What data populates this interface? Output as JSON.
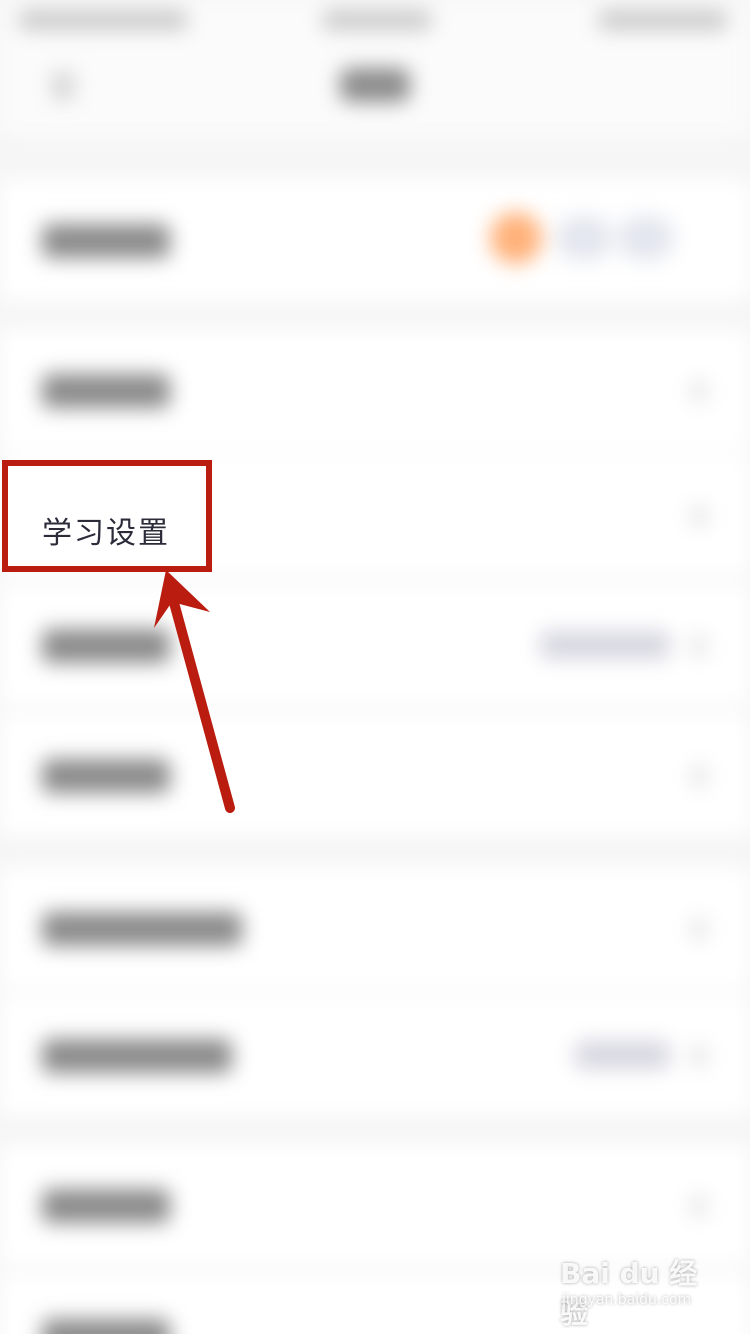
{
  "highlight": {
    "label": "学习设置"
  },
  "colors": {
    "highlight_border": "#bb1c10",
    "arrow": "#bb1c10",
    "accent_orange": "#ffb179"
  },
  "watermark": {
    "logo": "Bai du 经验",
    "sub": "jingyan.baidu.com"
  }
}
